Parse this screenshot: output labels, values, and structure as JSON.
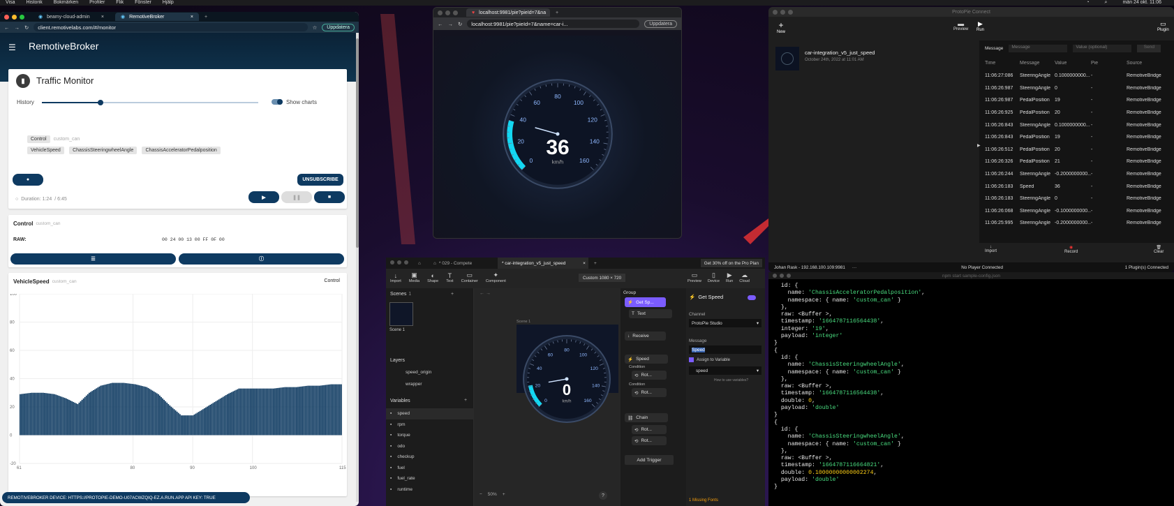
{
  "menubar": {
    "items": [
      "Visa",
      "Historik",
      "Bokmärken",
      "Profiler",
      "Flik",
      "Fönster",
      "Hjälp"
    ],
    "clock": "mån 24 okt. 11:06"
  },
  "browser1": {
    "tabs": [
      "beamy-cloud-admin",
      "RemotiveBroker"
    ],
    "url": "client.remotivelabs.com/#/monitor",
    "update": "Uppdatera",
    "app_title": "RemotiveBroker",
    "traffic": {
      "title": "Traffic Monitor",
      "history_label": "History",
      "history_value": 0.27,
      "show_charts": "Show charts",
      "namespace_chip": "Control",
      "namespace": "custom_can",
      "signals": [
        "VehicleSpeed",
        "ChassisSteeringwheelAngle",
        "ChassisAcceleratorPedalposition"
      ],
      "unsubscribe": "UNSUBSCRIBE",
      "duration": "Duration: 1:24",
      "total": "/ 6:45"
    },
    "control": {
      "title": "Control",
      "namespace": "custom_can",
      "raw_label": "RAW:",
      "raw": "00 24 00 13 00 FF 0F 00"
    },
    "speedcard": {
      "title": "VehicleSpeed",
      "namespace": "custom_can",
      "right": "Control"
    },
    "footer": "REMOTIVEBROKER DEVICE: HTTPS://PROTOPIE-DEMO-U07ACWZQIQ-EZ.A.RUN.APP API KEY: TRUE"
  },
  "chart_data": {
    "type": "bar",
    "title": "VehicleSpeed",
    "xlabel": "",
    "ylabel": "",
    "ylim": [
      -20,
      100
    ],
    "yticks": [
      100,
      80,
      60,
      40,
      20,
      0,
      -20
    ],
    "xticks": [
      "61",
      "80",
      "90",
      "100",
      "115"
    ],
    "xlim": [
      61,
      115
    ],
    "color": "#0e3a61",
    "x": [
      61,
      63,
      65,
      67,
      69,
      71,
      73,
      75,
      77,
      79,
      81,
      83,
      85,
      87,
      89,
      91,
      93,
      95,
      97,
      99,
      101,
      103,
      105,
      107,
      109,
      111,
      113,
      115
    ],
    "values": [
      29,
      30,
      30,
      29,
      26,
      22,
      30,
      35,
      37,
      37,
      36,
      34,
      29,
      21,
      14,
      14,
      19,
      24,
      29,
      33,
      33,
      33,
      33,
      34,
      34,
      35,
      35,
      36
    ]
  },
  "browser2": {
    "tabs": [
      "localhost:9981/pie?pieId=7&na"
    ],
    "url": "localhost:9981/pie?pieId=7&name=car-i...",
    "update": "Uppdatera",
    "gauge": {
      "value": "36",
      "unit": "km/h",
      "labels": [
        "0",
        "20",
        "40",
        "60",
        "80",
        "100",
        "120",
        "140",
        "160"
      ],
      "fraction": 0.225
    }
  },
  "connect": {
    "title": "ProtoPie Connect",
    "toolbar": {
      "new": "New",
      "preview": "Preview",
      "run": "Run",
      "plugin": "Plugin"
    },
    "pie": {
      "name": "car-integration_v5_just_speed",
      "date": "October 24th, 2022 at 11:01 AM"
    },
    "message_label": "Message",
    "message_placeholder": "Message",
    "value_placeholder": "Value (optional)",
    "send": "Send",
    "columns": [
      "Time",
      "Message",
      "Value",
      "Pie",
      "Source"
    ],
    "rows": [
      [
        "11:06:27:086",
        "SteeringAngle",
        "0.1000000000...",
        "-",
        "RemotiveBridge"
      ],
      [
        "11:06:26:987",
        "SteeringAngle",
        "0",
        "-",
        "RemotiveBridge"
      ],
      [
        "11:06:26:987",
        "PedalPosition",
        "19",
        "-",
        "RemotiveBridge"
      ],
      [
        "11:06:26:925",
        "PedalPosition",
        "20",
        "-",
        "RemotiveBridge"
      ],
      [
        "11:06:26:843",
        "SteeringAngle",
        "0.1000000000...",
        "-",
        "RemotiveBridge"
      ],
      [
        "11:06:26:843",
        "PedalPosition",
        "19",
        "-",
        "RemotiveBridge"
      ],
      [
        "11:06:26:512",
        "PedalPosition",
        "20",
        "-",
        "RemotiveBridge"
      ],
      [
        "11:06:26:326",
        "PedalPosition",
        "21",
        "-",
        "RemotiveBridge"
      ],
      [
        "11:06:26:244",
        "SteeringAngle",
        "-0.2000000000...",
        "-",
        "RemotiveBridge"
      ],
      [
        "11:06:26:183",
        "Speed",
        "36",
        "-",
        "RemotiveBridge"
      ],
      [
        "11:06:26:183",
        "SteeringAngle",
        "0",
        "-",
        "RemotiveBridge"
      ],
      [
        "11:06:26:068",
        "SteeringAngle",
        "-0.1000000000...",
        "-",
        "RemotiveBridge"
      ],
      [
        "11:06:25:995",
        "SteeringAngle",
        "-0.2000000000...",
        "-",
        "RemotiveBridge"
      ]
    ],
    "bottom": {
      "import": "Import",
      "record": "Record",
      "clear": "Clear"
    },
    "status": {
      "user": "Johan Rask - 192.168.100.109:9981",
      "player": "No Player Connected",
      "plugins": "1 Plugin(s) Connected"
    }
  },
  "terminal": {
    "title": "npm start sample-config.json"
  },
  "studio": {
    "tabs": [
      "* 029 - Compete",
      "* car-integration_v5_just_speed"
    ],
    "promo": "Get 30% off on the Pro Plan",
    "tools": [
      "Import",
      "Media",
      "Shape",
      "Text",
      "Container",
      "Component"
    ],
    "right_tools": [
      "Preview",
      "Device",
      "Run",
      "Cloud"
    ],
    "canvas_size": "Custom  1080 × 720",
    "scenes_label": "Scenes",
    "scenes_count": "1",
    "scene_name": "Scene 1",
    "canvas_scene": "Scene 1",
    "layers_label": "Layers",
    "layers": [
      "speed_origin",
      "wrapper"
    ],
    "variables_label": "Variables",
    "variables": [
      "speed",
      "rpm",
      "torque",
      "odo",
      "checkup",
      "fuel",
      "fuel_rate",
      "runtime"
    ],
    "gauge": {
      "value": "0",
      "unit": "km/h",
      "labels": [
        "0",
        "20",
        "40",
        "60",
        "80",
        "100",
        "120",
        "140",
        "160"
      ]
    },
    "zoom": "50%",
    "group": "Group",
    "triggers": [
      "Get Sp...",
      "Receive",
      "Speed",
      "Chain"
    ],
    "responses": [
      "Text",
      "Condition",
      "Rot...",
      "Condition",
      "Rot...",
      "Rot...",
      "Rot..."
    ],
    "add_trigger": "Add Trigger",
    "panel": {
      "title": "Get Speed",
      "channel_label": "Channel",
      "channel": "ProtoPie Studio",
      "message_label": "Message",
      "message": "Speed",
      "assign": "Assign to Variable",
      "variable": "speed",
      "help": "How to use variables?"
    },
    "missing_fonts": "1 Missing Fonts"
  }
}
